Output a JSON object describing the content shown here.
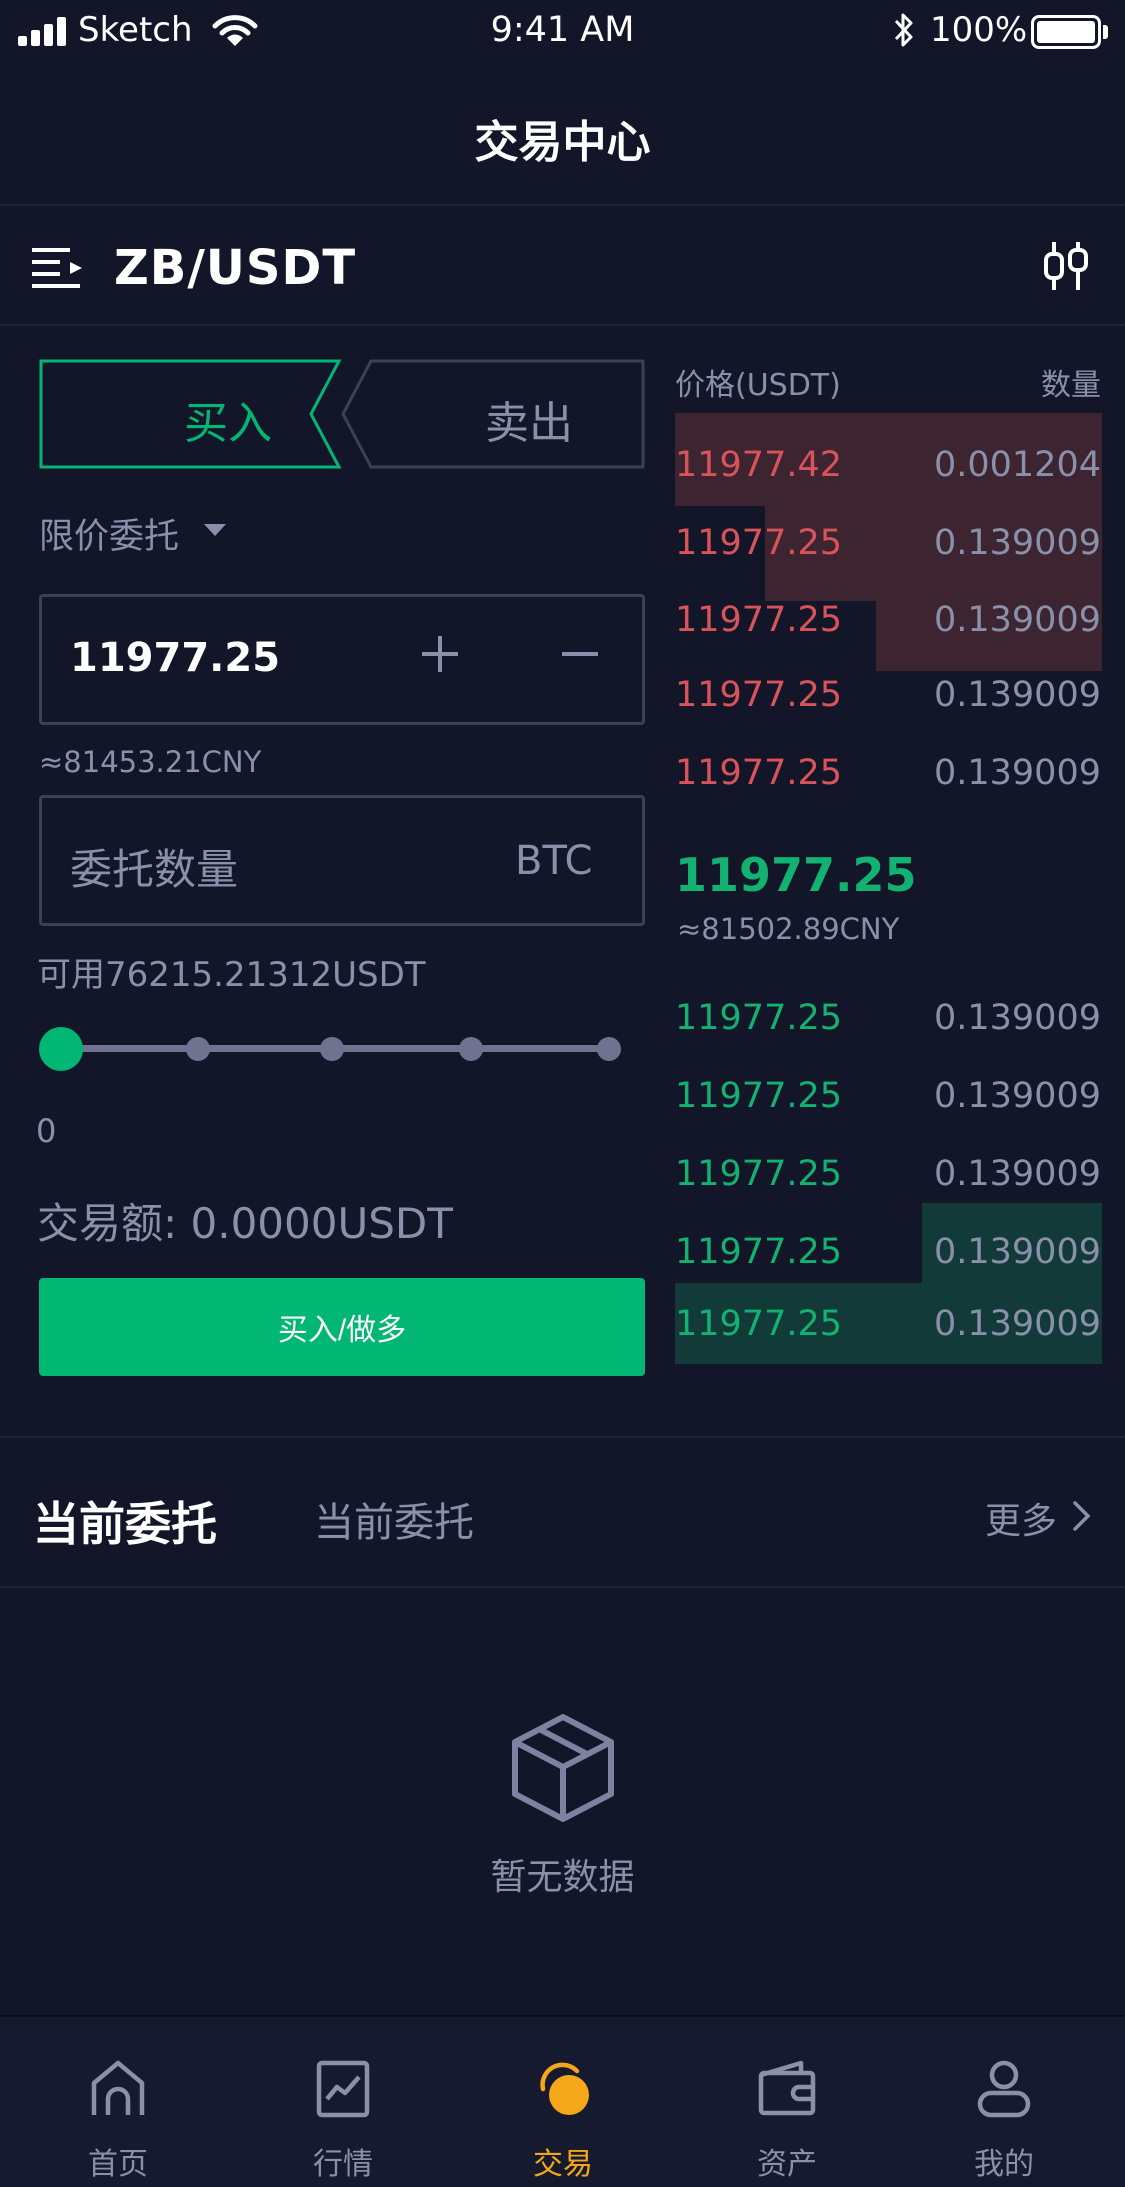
{
  "status_bar": {
    "carrier": "Sketch",
    "time": "9:41 AM",
    "battery": "100%"
  },
  "nav": {
    "title": "交易中心"
  },
  "pair": {
    "label": "ZB/USDT"
  },
  "trade_form": {
    "buy_tab": "买入",
    "sell_tab": "卖出",
    "order_type": "限价委托",
    "price_value": "11977.25",
    "price_cny": "≈81453.21CNY",
    "qty_placeholder": "委托数量",
    "qty_unit": "BTC",
    "available": "可用76215.21312USDT",
    "slider_value": "0",
    "slider_fraction": 0,
    "trade_amount": "交易额: 0.0000USDT",
    "submit_label": "买入/做多"
  },
  "order_book": {
    "price_header": "价格(USDT)",
    "qty_header": "数量",
    "asks": [
      {
        "price": "11977.42",
        "qty": "0.001204"
      },
      {
        "price": "11977.25",
        "qty": "0.139009"
      },
      {
        "price": "11977.25",
        "qty": "0.139009"
      },
      {
        "price": "11977.25",
        "qty": "0.139009"
      },
      {
        "price": "11977.25",
        "qty": "0.139009"
      }
    ],
    "last_price": "11977.25",
    "last_price_cny": "≈81502.89CNY",
    "bids": [
      {
        "price": "11977.25",
        "qty": "0.139009"
      },
      {
        "price": "11977.25",
        "qty": "0.139009"
      },
      {
        "price": "11977.25",
        "qty": "0.139009"
      },
      {
        "price": "11977.25",
        "qty": "0.139009"
      },
      {
        "price": "11977.25",
        "qty": "0.139009"
      }
    ]
  },
  "orders_section": {
    "title": "当前委托",
    "tab2": "当前委托",
    "more": "更多",
    "empty_text": "暂无数据"
  },
  "tabbar": {
    "items": [
      {
        "label": "首页",
        "icon": "home-icon"
      },
      {
        "label": "行情",
        "icon": "chart-icon"
      },
      {
        "label": "交易",
        "icon": "trade-icon"
      },
      {
        "label": "资产",
        "icon": "wallet-icon"
      },
      {
        "label": "我的",
        "icon": "user-icon"
      }
    ],
    "active_index": 2
  },
  "colors": {
    "background": "#131628",
    "buy_green": "#02b673",
    "ask_red": "#d8545a",
    "bid_green": "#12b271",
    "active_tab": "#f5a71a"
  }
}
